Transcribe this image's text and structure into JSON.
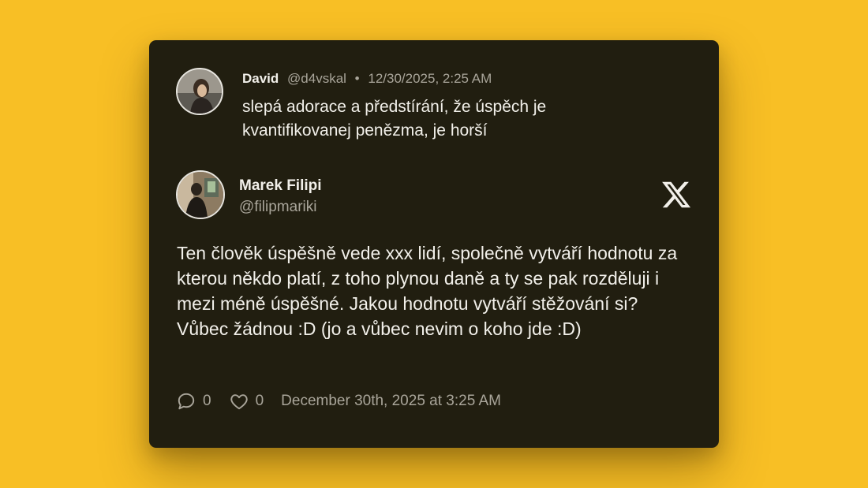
{
  "reply": {
    "author_name": "David",
    "handle": "@d4vskal",
    "separator": "•",
    "timestamp": "12/30/2025, 2:25 AM",
    "text": "slepá adorace a předstírání, že úspěch je kvantifikovanej penězma, je horší",
    "avatar_icon": "user-photo"
  },
  "tweet": {
    "author_name": "Marek Filipi",
    "handle": "@filipmariki",
    "text": "Ten člověk úspěšně vede xxx lidí, společně vytváří hodnotu za kterou někdo platí, z toho plynou daně a ty se pak rozděluji i mezi méně úspěšné. Jakou hodnotu vytváří stěžování si? Vůbec žádnou :D (jo a vůbec nevim o koho jde :D)",
    "avatar_icon": "user-photo",
    "platform_icon": "x-logo",
    "reply_count": "0",
    "like_count": "0",
    "timestamp": "December 30th, 2025 at 3:25 AM"
  },
  "colors": {
    "background": "#f8bf25",
    "card": "#211e10",
    "text": "#f2f0ea",
    "muted": "#a9a59a"
  }
}
